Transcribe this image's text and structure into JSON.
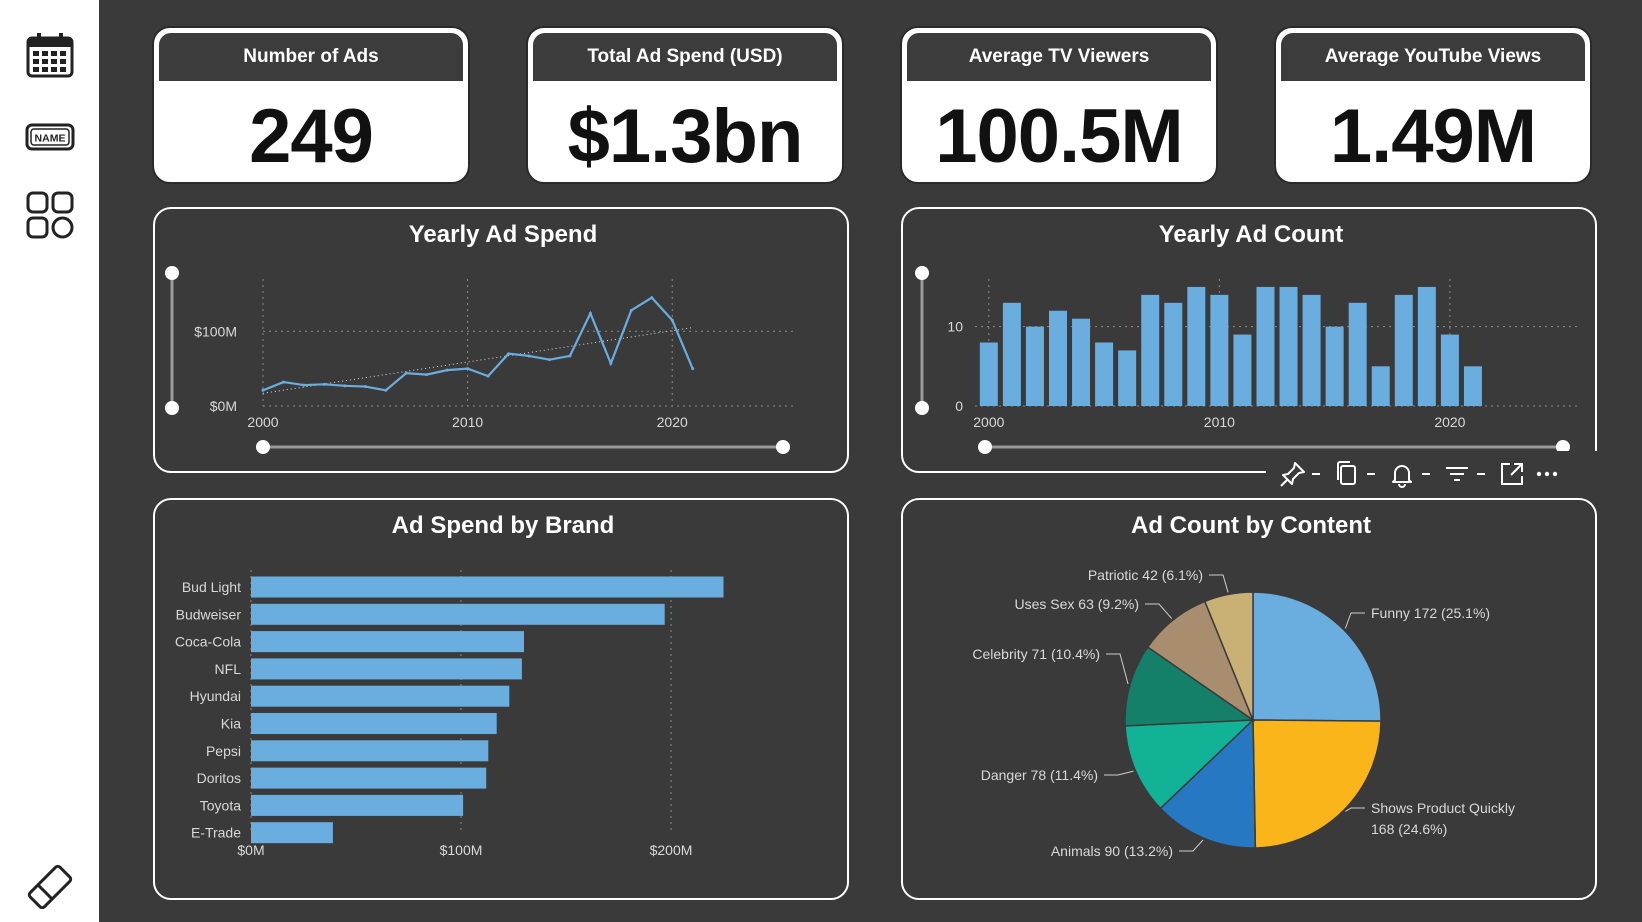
{
  "sidebar": {
    "icons": [
      "calendar-icon",
      "name-badge-icon",
      "grid-icon",
      "eraser-icon"
    ],
    "name_badge_text": "NAME"
  },
  "kpis": [
    {
      "title": "Number of Ads",
      "value": "249"
    },
    {
      "title": "Total Ad Spend (USD)",
      "value": "$1.3bn"
    },
    {
      "title": "Average TV Viewers",
      "value": "100.5M"
    },
    {
      "title": "Average YouTube Views",
      "value": "1.49M"
    }
  ],
  "toolbar": {
    "icons": [
      "pin-icon",
      "copy-icon",
      "bell-icon",
      "filter-icon",
      "expand-icon",
      "more-icon"
    ]
  },
  "chart_data": [
    {
      "type": "line",
      "title": "Yearly Ad Spend",
      "x": [
        2000,
        2001,
        2002,
        2003,
        2004,
        2005,
        2006,
        2007,
        2008,
        2009,
        2010,
        2011,
        2012,
        2013,
        2014,
        2015,
        2016,
        2017,
        2018,
        2019,
        2020,
        2021
      ],
      "values": [
        21,
        32,
        28,
        29,
        27,
        26,
        21,
        44,
        42,
        48,
        50,
        40,
        70,
        67,
        62,
        67,
        124,
        57,
        128,
        145,
        115,
        50
      ],
      "trendline": {
        "from": [
          2000,
          17
        ],
        "to": [
          2021,
          105
        ]
      },
      "ylim": [
        0,
        170
      ],
      "yticks": [
        {
          "value": 0,
          "label": "$0M"
        },
        {
          "value": 100,
          "label": "$100M"
        }
      ],
      "xticks": [
        2000,
        2010,
        2020
      ],
      "xlim": [
        2000,
        2026
      ],
      "grid": true,
      "color": "#6aaee0"
    },
    {
      "type": "bar",
      "title": "Yearly Ad Count",
      "categories": [
        2000,
        2001,
        2002,
        2003,
        2004,
        2005,
        2006,
        2007,
        2008,
        2009,
        2010,
        2011,
        2012,
        2013,
        2014,
        2015,
        2016,
        2017,
        2018,
        2019,
        2020,
        2021
      ],
      "values": [
        8,
        13,
        10,
        12,
        11,
        8,
        7,
        14,
        13,
        15,
        14,
        9,
        15,
        15,
        14,
        10,
        13,
        5,
        14,
        15,
        9,
        5
      ],
      "ylim": [
        0,
        16
      ],
      "yticks": [
        0,
        10
      ],
      "xticks": [
        2000,
        2010,
        2020
      ],
      "xlim": [
        1999.4,
        2025.6
      ],
      "grid": true,
      "color": "#6aaee0"
    },
    {
      "type": "bar",
      "orientation": "horizontal",
      "title": "Ad Spend by Brand",
      "categories": [
        "Bud Light",
        "Budweiser",
        "Coca-Cola",
        "NFL",
        "Hyundai",
        "Kia",
        "Pepsi",
        "Doritos",
        "Toyota",
        "E-Trade"
      ],
      "values": [
        225,
        197,
        130,
        129,
        123,
        117,
        113,
        112,
        101,
        39
      ],
      "xlim": [
        0,
        260
      ],
      "xticks": [
        {
          "value": 0,
          "label": "$0M"
        },
        {
          "value": 100,
          "label": "$100M"
        },
        {
          "value": 200,
          "label": "$200M"
        }
      ],
      "grid": true,
      "color": "#6aaee0"
    },
    {
      "type": "pie",
      "title": "Ad Count by Content",
      "slices": [
        {
          "label": "Funny",
          "value": 172,
          "pct": "25.1%",
          "text": "Funny 172 (25.1%)",
          "color": "#6aaee0"
        },
        {
          "label": "Shows Product Quickly",
          "value": 168,
          "pct": "24.6%",
          "text": "Shows Product Quickly",
          "text2": "168 (24.6%)",
          "color": "#fab51a"
        },
        {
          "label": "Animals",
          "value": 90,
          "pct": "13.2%",
          "text": "Animals 90 (13.2%)",
          "color": "#2678c3"
        },
        {
          "label": "Danger",
          "value": 78,
          "pct": "11.4%",
          "text": "Danger 78 (11.4%)",
          "color": "#12b296"
        },
        {
          "label": "Celebrity",
          "value": 71,
          "pct": "10.4%",
          "text": "Celebrity 71 (10.4%)",
          "color": "#148069"
        },
        {
          "label": "Uses Sex",
          "value": 63,
          "pct": "9.2%",
          "text": "Uses Sex 63 (9.2%)",
          "color": "#a88d6e"
        },
        {
          "label": "Patriotic",
          "value": 42,
          "pct": "6.1%",
          "text": "Patriotic 42 (6.1%)",
          "color": "#c9b074"
        }
      ]
    }
  ]
}
